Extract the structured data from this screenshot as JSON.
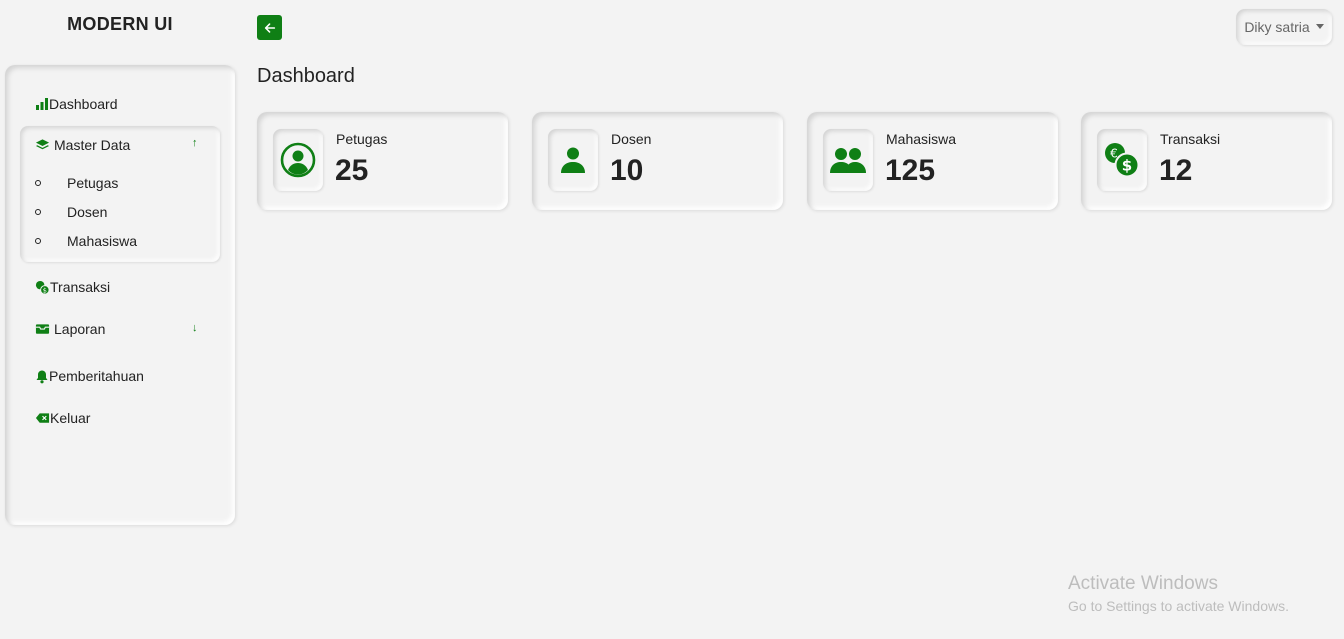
{
  "brand": "MODERN UI",
  "header": {
    "user_name": "Diky satria"
  },
  "sidebar": {
    "items": [
      {
        "label": "Dashboard",
        "icon": "bar-chart-icon"
      },
      {
        "label": "Master Data",
        "icon": "layers-icon",
        "expanded": true,
        "children": [
          "Petugas",
          "Dosen",
          "Mahasiswa"
        ]
      },
      {
        "label": "Transaksi",
        "icon": "coins-icon"
      },
      {
        "label": "Laporan",
        "icon": "inbox-icon",
        "expanded": false
      },
      {
        "label": "Pemberitahuan",
        "icon": "bell-icon"
      },
      {
        "label": "Keluar",
        "icon": "backspace-icon"
      }
    ]
  },
  "main": {
    "title": "Dashboard",
    "cards": [
      {
        "label": "Petugas",
        "value": "25",
        "icon": "user-circle-icon"
      },
      {
        "label": "Dosen",
        "value": "10",
        "icon": "person-icon"
      },
      {
        "label": "Mahasiswa",
        "value": "125",
        "icon": "people-icon"
      },
      {
        "label": "Transaksi",
        "value": "12",
        "icon": "currency-exchange-icon"
      }
    ]
  },
  "watermark": {
    "line1": "Activate Windows",
    "line2": "Go to Settings to activate Windows."
  },
  "colors": {
    "accent": "#0f7f15",
    "background": "#f3f3f3",
    "text": "#222222"
  }
}
